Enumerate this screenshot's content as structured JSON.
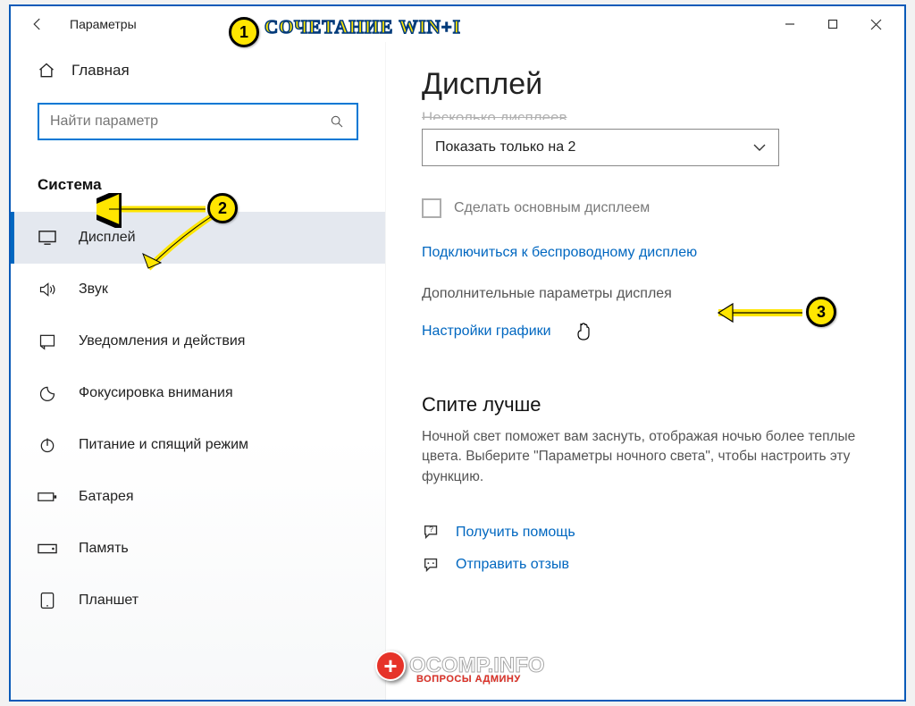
{
  "titlebar": {
    "title": "Параметры"
  },
  "annotation": {
    "hint": "СОЧЕТАНИЕ  WIN+I",
    "badge1": "1",
    "badge2": "2",
    "badge3": "3"
  },
  "sidebar": {
    "home": "Главная",
    "search_placeholder": "Найти параметр",
    "category": "Система",
    "items": [
      {
        "label": "Дисплей"
      },
      {
        "label": "Звук"
      },
      {
        "label": "Уведомления и действия"
      },
      {
        "label": "Фокусировка внимания"
      },
      {
        "label": "Питание и спящий режим"
      },
      {
        "label": "Батарея"
      },
      {
        "label": "Память"
      },
      {
        "label": "Планшет"
      }
    ]
  },
  "main": {
    "heading": "Дисплей",
    "multi_label_cut": "Несколько дисплеев",
    "dropdown_value": "Показать только на 2",
    "checkbox_label": "Сделать основным дисплеем",
    "link_wireless": "Подключиться к беспроводному дисплею",
    "link_advanced": "Дополнительные параметры дисплея",
    "link_graphics": "Настройки графики",
    "sleep_heading": "Спите лучше",
    "sleep_text": "Ночной свет поможет вам заснуть, отображая ночью более теплые цвета. Выберите \"Параметры ночного света\", чтобы настроить эту функцию.",
    "help_get": "Получить помощь",
    "help_feedback": "Отправить отзыв"
  },
  "watermark": {
    "main": "OCOMP.INFO",
    "sub": "ВОПРОСЫ АДМИНУ"
  }
}
